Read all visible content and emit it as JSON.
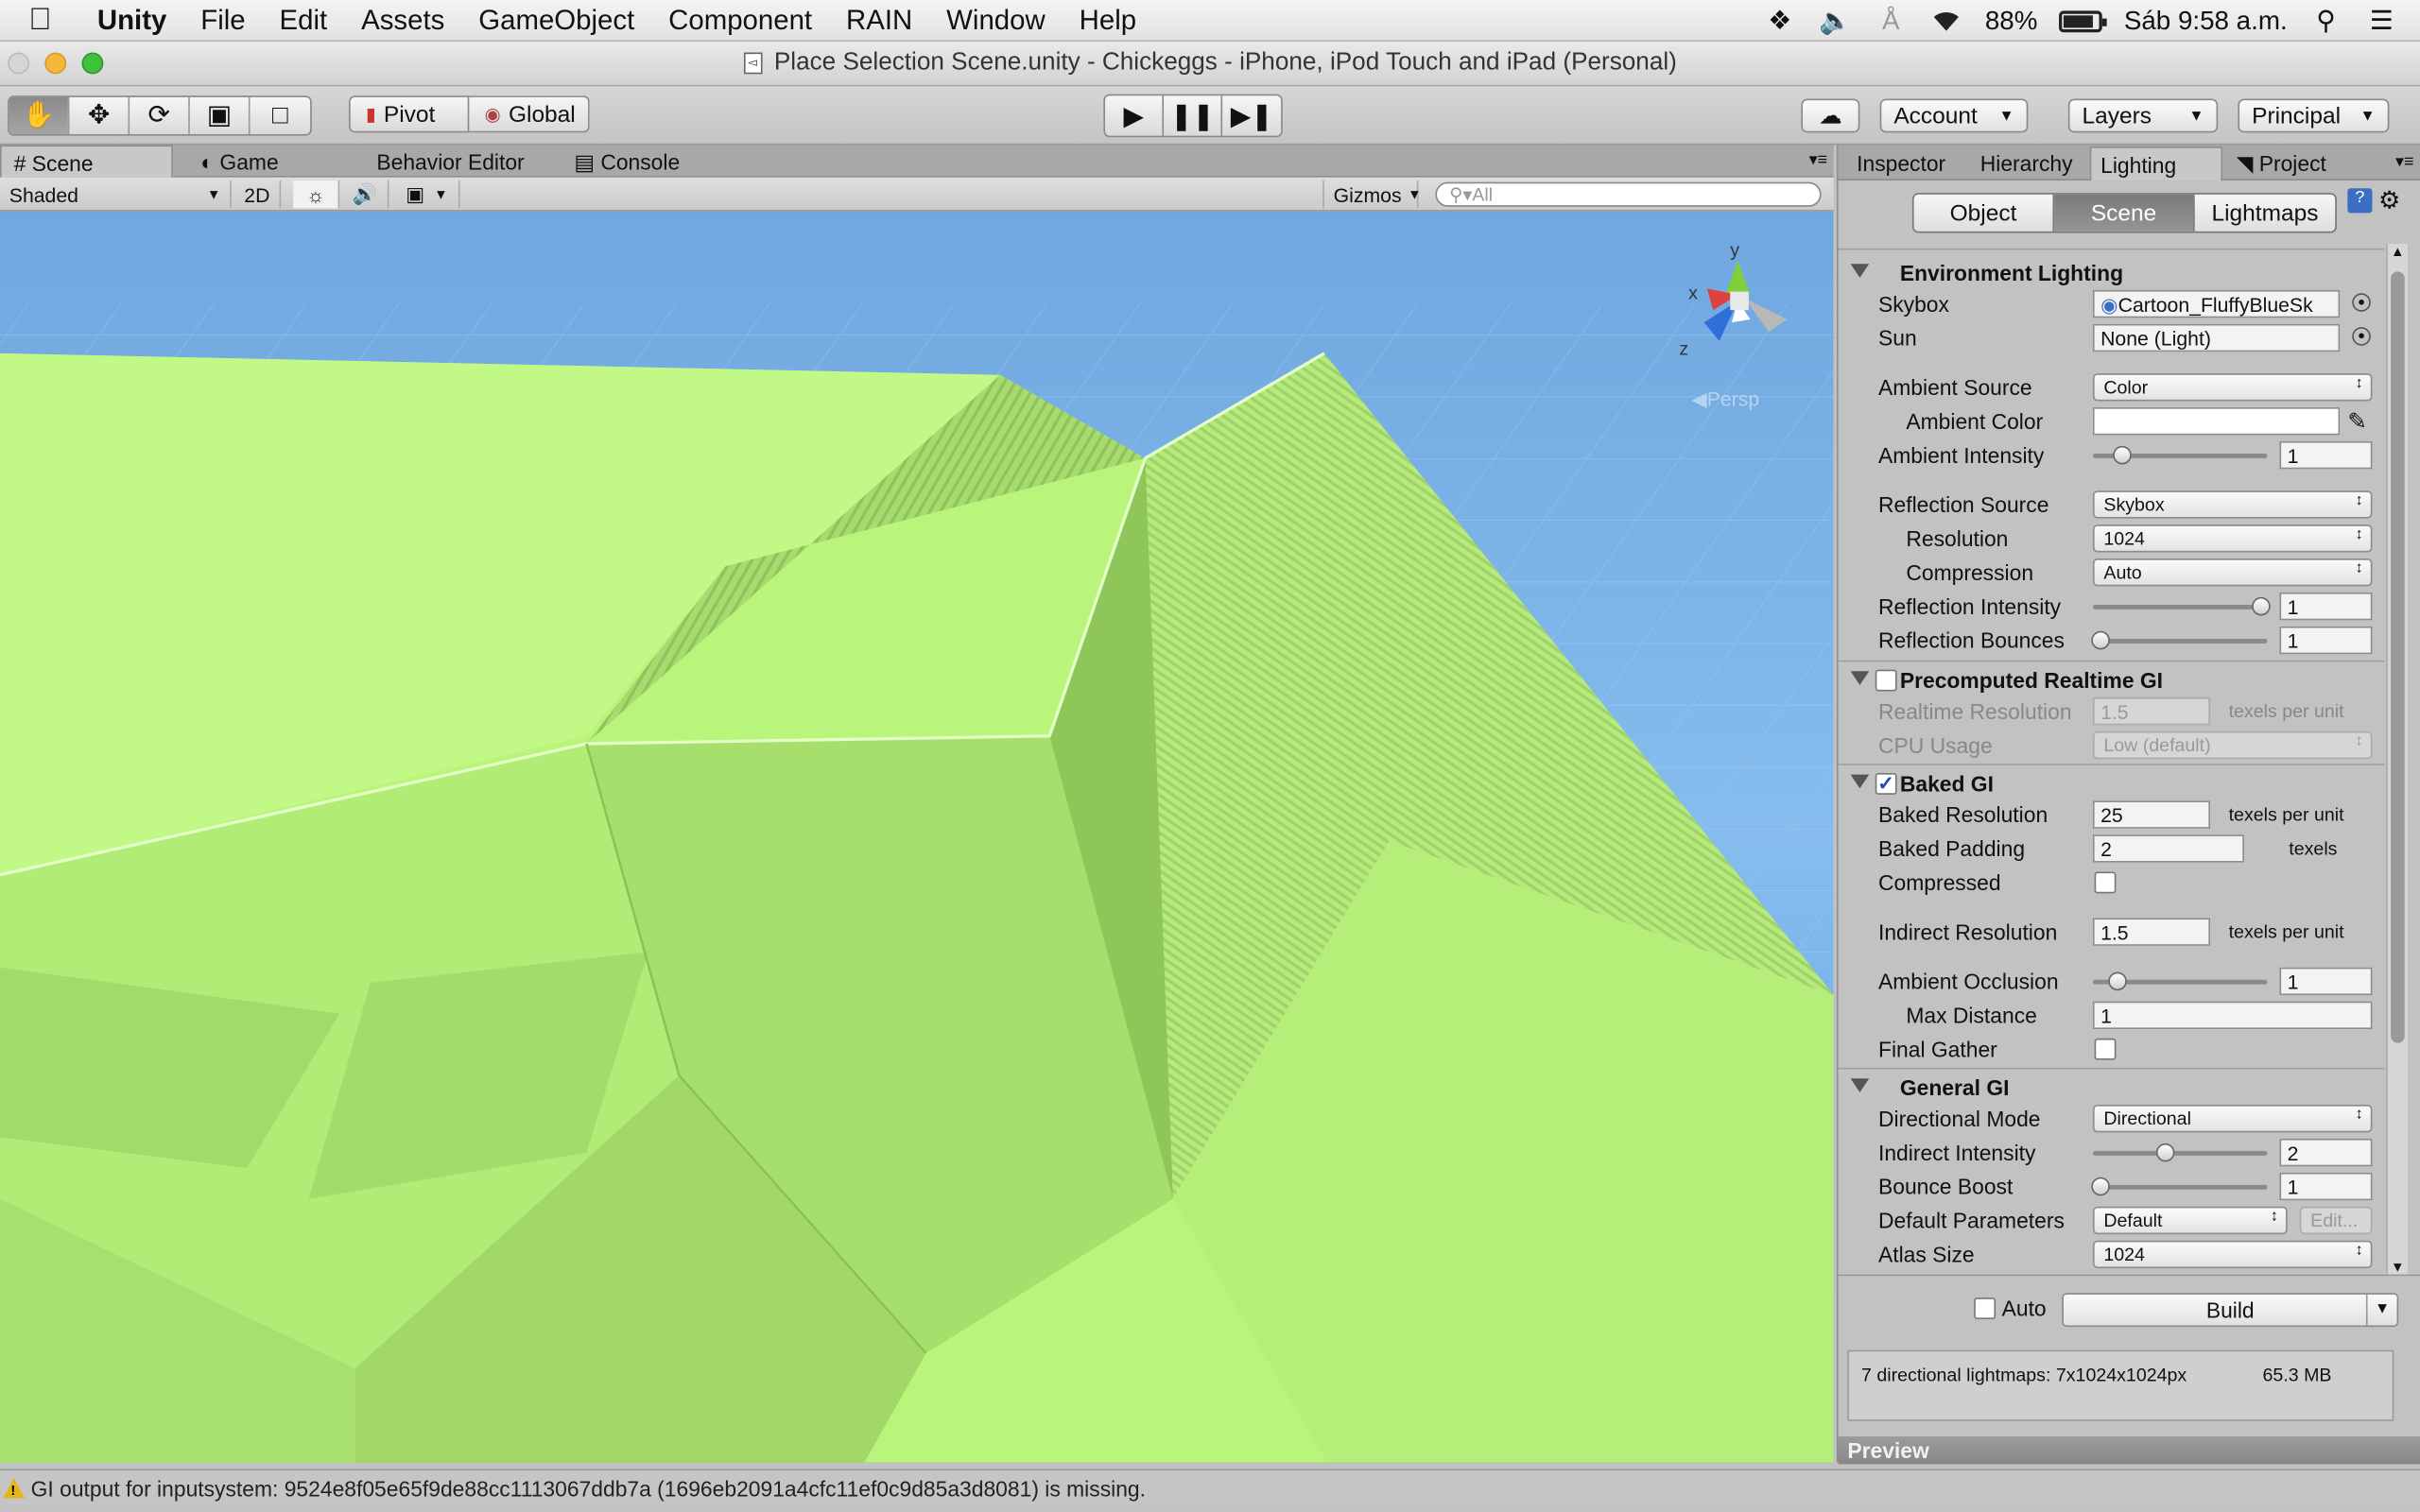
{
  "menubar": {
    "app": "Unity",
    "items": [
      "File",
      "Edit",
      "Assets",
      "GameObject",
      "Component",
      "RAIN",
      "Window",
      "Help"
    ],
    "battery": "88%",
    "battery_level": 0.88,
    "clock": "Sáb 9:58 a.m."
  },
  "window": {
    "title": "Place Selection Scene.unity - Chickeggs - iPhone, iPod Touch and iPad (Personal)"
  },
  "toolbar": {
    "pivot": "Pivot",
    "global": "Global",
    "account": "Account",
    "layers": "Layers",
    "layout": "Principal"
  },
  "scene_tabs": {
    "scene": "Scene",
    "game": "Game",
    "behavior": "Behavior Editor",
    "console": "Console"
  },
  "scene_toolbar": {
    "draw_mode": "Shaded",
    "mode_2d": "2D",
    "gizmos": "Gizmos",
    "search_placeholder": "All"
  },
  "viewport": {
    "gizmo_axes": [
      "y",
      "x",
      "z"
    ],
    "projection": "Persp"
  },
  "right_tabs": {
    "inspector": "Inspector",
    "hierarchy": "Hierarchy",
    "lighting": "Lighting",
    "project": "Project"
  },
  "lighting": {
    "segments": [
      "Object",
      "Scene",
      "Lightmaps"
    ],
    "environment": {
      "header": "Environment Lighting",
      "skybox_label": "Skybox",
      "skybox_value": "Cartoon_FluffyBlueSk",
      "sun_label": "Sun",
      "sun_value": "None (Light)",
      "ambient_source_label": "Ambient Source",
      "ambient_source_value": "Color",
      "ambient_color_label": "Ambient Color",
      "ambient_intensity_label": "Ambient Intensity",
      "ambient_intensity_value": "1",
      "reflection_source_label": "Reflection Source",
      "reflection_source_value": "Skybox",
      "resolution_label": "Resolution",
      "resolution_value": "1024",
      "compression_label": "Compression",
      "compression_value": "Auto",
      "reflection_intensity_label": "Reflection Intensity",
      "reflection_intensity_value": "1",
      "reflection_bounces_label": "Reflection Bounces",
      "reflection_bounces_value": "1"
    },
    "realtime": {
      "header": "Precomputed Realtime GI",
      "enabled": false,
      "resolution_label": "Realtime Resolution",
      "resolution_value": "1.5",
      "resolution_unit": "texels per unit",
      "cpu_label": "CPU Usage",
      "cpu_value": "Low (default)"
    },
    "baked": {
      "header": "Baked GI",
      "enabled": true,
      "resolution_label": "Baked Resolution",
      "resolution_value": "25",
      "resolution_unit": "texels per unit",
      "padding_label": "Baked Padding",
      "padding_value": "2",
      "padding_unit": "texels",
      "compressed_label": "Compressed",
      "indirect_resolution_label": "Indirect Resolution",
      "indirect_resolution_value": "1.5",
      "indirect_resolution_unit": "texels per unit",
      "ao_label": "Ambient Occlusion",
      "ao_value": "1",
      "max_distance_label": "Max Distance",
      "max_distance_value": "1",
      "final_gather_label": "Final Gather"
    },
    "general": {
      "header": "General GI",
      "directional_label": "Directional Mode",
      "directional_value": "Directional",
      "indirect_intensity_label": "Indirect Intensity",
      "indirect_intensity_value": "2",
      "bounce_boost_label": "Bounce Boost",
      "bounce_boost_value": "1",
      "default_params_label": "Default Parameters",
      "default_params_value": "Default",
      "edit_label": "Edit...",
      "atlas_label": "Atlas Size",
      "atlas_value": "1024"
    },
    "auto_label": "Auto",
    "build_label": "Build",
    "info_text": "7 directional lightmaps: 7x1024x1024px",
    "info_size": "65.3 MB",
    "preview_label": "Preview"
  },
  "status": {
    "message": "GI output for inputsystem: 9524e8f05e65f9de88cc1113067ddb7a (1696eb2091a4cfc11ef0c9d85a3d8081) is missing."
  },
  "colors": {
    "terrain": "#b8f57a",
    "sky": "#7fb6e8",
    "grass": "#4f8a22"
  }
}
